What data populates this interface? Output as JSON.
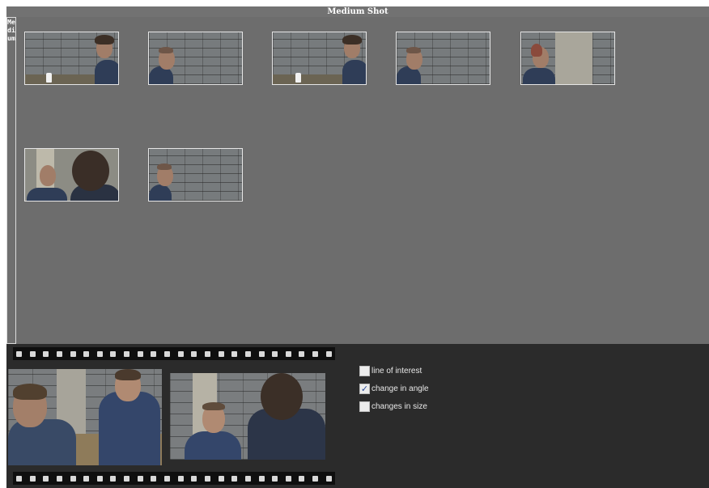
{
  "panel": {
    "title": "Medium Shot",
    "side_label": "Medium"
  },
  "thumbnails": [
    {
      "id": "shot-1",
      "scene": "man-right-bottle"
    },
    {
      "id": "shot-2",
      "scene": "man-left"
    },
    {
      "id": "shot-3",
      "scene": "man-right-bottle"
    },
    {
      "id": "shot-4",
      "scene": "man-left"
    },
    {
      "id": "shot-5",
      "scene": "man-pillar"
    },
    {
      "id": "shot-6",
      "scene": "two-shot-over-shoulder"
    },
    {
      "id": "shot-7",
      "scene": "man-left"
    }
  ],
  "filmstrip": {
    "frames": [
      {
        "scene": "two-men-table"
      },
      {
        "scene": "over-shoulder"
      }
    ]
  },
  "options": [
    {
      "label": "line of interest",
      "checked": false
    },
    {
      "label": "change in angle",
      "checked": true
    },
    {
      "label": "changes in size",
      "checked": false
    }
  ],
  "colors": {
    "panel_bg": "#6d6d6d",
    "title_bar": "#727272",
    "bottom_bg": "#2b2b2b",
    "checkmark": "#2a4a9a"
  }
}
